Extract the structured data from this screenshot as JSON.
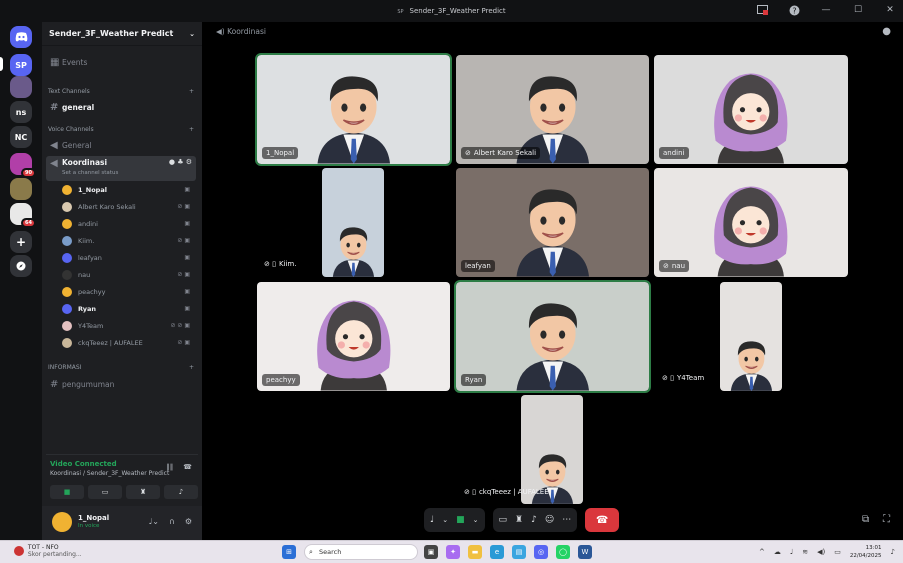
{
  "window": {
    "title": "Sender_3F_Weather Predict",
    "logo_text": "SP"
  },
  "rail": {
    "servers": [
      {
        "label": "SP",
        "color": "#5865f2",
        "selected": true
      },
      {
        "label": "",
        "color": "#6a5a8a"
      },
      {
        "label": "ns",
        "color": "#313338"
      },
      {
        "label": "NC",
        "color": "#313338"
      },
      {
        "label": "",
        "color": "#b13fa8",
        "badge": "90"
      },
      {
        "label": "",
        "color": "#8a7a4a"
      },
      {
        "label": "",
        "color": "#e8e8e8",
        "badge": "64"
      }
    ]
  },
  "sidebar": {
    "server_name": "Sender_3F_Weather Predict",
    "events": "Events",
    "text_category": "Text Channels",
    "text_channels": [
      "general"
    ],
    "voice_category": "Voice Channels",
    "voice_channels": [
      "General",
      "Koordinasi"
    ],
    "channel_status": "Set a channel status",
    "voice_users": [
      {
        "name": "1_Nopal",
        "color": "#f0b232",
        "bold": true,
        "icon": "▣"
      },
      {
        "name": "Albert Karo Sekali",
        "color": "#d9c9b0",
        "icon": "⊘ ▣"
      },
      {
        "name": "andini",
        "color": "#f0b232",
        "icon": "▣"
      },
      {
        "name": "Kiim.",
        "color": "#7a9cc9",
        "icon": "⊘ ▣"
      },
      {
        "name": "leafyan",
        "color": "#5865f2",
        "icon": "▣"
      },
      {
        "name": "nau",
        "color": "#333",
        "icon": "⊘ ▣"
      },
      {
        "name": "peachyy",
        "color": "#f0b232",
        "icon": "▣"
      },
      {
        "name": "Ryan",
        "color": "#5865f2",
        "bold": true,
        "icon": "▣"
      },
      {
        "name": "Y4Team",
        "color": "#e3c0c0",
        "icon": "⊘ ⊘ ▣"
      },
      {
        "name": "ckqTeeez | AUFALEE",
        "color": "#c9b79a",
        "icon": "⊘ ▣"
      }
    ],
    "info_category": "INFORMASI",
    "info_channels": [
      "pengumuman"
    ]
  },
  "voice_panel": {
    "status": "Video Connected",
    "location": "Koordinasi / Sender_3F_Weather Predict",
    "buttons": [
      "camera",
      "screen-share",
      "activity",
      "soundboard"
    ]
  },
  "user_panel": {
    "name": "1_Nopal",
    "status": "In voice"
  },
  "call": {
    "channel": "Koordinasi",
    "tiles": [
      {
        "label": "1_Nopal",
        "avatar": "boy",
        "speaking": true,
        "bg": "#dde0e2"
      },
      {
        "label": "Albert Karo Sekali",
        "prefix": "⊘",
        "avatar": "boy",
        "bg": "#b8b5b2"
      },
      {
        "label": "andini",
        "avatar": "girl",
        "bg": "#dcdcdc"
      },
      {
        "label": "Kiim.",
        "prefix": "⊘ ▯",
        "avatar": "boy",
        "bg": "#c7d1db"
      },
      {
        "label": "leafyan",
        "avatar": "boy",
        "bg": "#7a6e68"
      },
      {
        "label": "nau",
        "prefix": "⊘",
        "avatar": "girl",
        "bg": "#e9e6e4"
      },
      {
        "label": "peachyy",
        "avatar": "girl",
        "bg": "#efeceb"
      },
      {
        "label": "Ryan",
        "avatar": "boy",
        "speaking": true,
        "bg": "#c9cfca"
      },
      {
        "label": "Y4Team",
        "prefix": "⊘ ▯",
        "avatar": "boy",
        "bg": "#e5e2e0"
      },
      {
        "label": "ckqTeeez | AUFALEE",
        "prefix": "⊘ ▯",
        "avatar": "boy",
        "bg": "#d8d6d4"
      }
    ]
  },
  "taskbar": {
    "news_title": "TOT - NFO",
    "news_sub": "Skor pertanding...",
    "news_badge": "3",
    "search_placeholder": "Search",
    "time": "13:01",
    "date": "22/04/2025",
    "discord_badge": "64"
  }
}
